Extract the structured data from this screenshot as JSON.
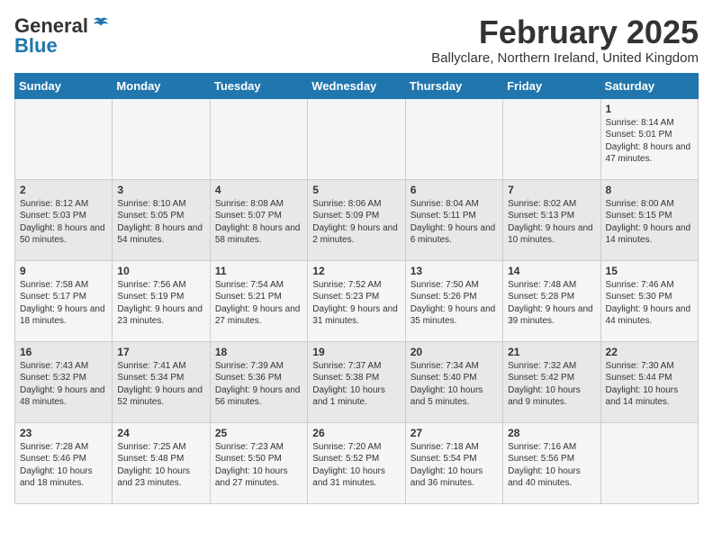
{
  "logo": {
    "general": "General",
    "blue": "Blue"
  },
  "title": "February 2025",
  "subtitle": "Ballyclare, Northern Ireland, United Kingdom",
  "days_of_week": [
    "Sunday",
    "Monday",
    "Tuesday",
    "Wednesday",
    "Thursday",
    "Friday",
    "Saturday"
  ],
  "weeks": [
    [
      {
        "day": "",
        "content": ""
      },
      {
        "day": "",
        "content": ""
      },
      {
        "day": "",
        "content": ""
      },
      {
        "day": "",
        "content": ""
      },
      {
        "day": "",
        "content": ""
      },
      {
        "day": "",
        "content": ""
      },
      {
        "day": "1",
        "content": "Sunrise: 8:14 AM\nSunset: 5:01 PM\nDaylight: 8 hours and 47 minutes."
      }
    ],
    [
      {
        "day": "2",
        "content": "Sunrise: 8:12 AM\nSunset: 5:03 PM\nDaylight: 8 hours and 50 minutes."
      },
      {
        "day": "3",
        "content": "Sunrise: 8:10 AM\nSunset: 5:05 PM\nDaylight: 8 hours and 54 minutes."
      },
      {
        "day": "4",
        "content": "Sunrise: 8:08 AM\nSunset: 5:07 PM\nDaylight: 8 hours and 58 minutes."
      },
      {
        "day": "5",
        "content": "Sunrise: 8:06 AM\nSunset: 5:09 PM\nDaylight: 9 hours and 2 minutes."
      },
      {
        "day": "6",
        "content": "Sunrise: 8:04 AM\nSunset: 5:11 PM\nDaylight: 9 hours and 6 minutes."
      },
      {
        "day": "7",
        "content": "Sunrise: 8:02 AM\nSunset: 5:13 PM\nDaylight: 9 hours and 10 minutes."
      },
      {
        "day": "8",
        "content": "Sunrise: 8:00 AM\nSunset: 5:15 PM\nDaylight: 9 hours and 14 minutes."
      }
    ],
    [
      {
        "day": "9",
        "content": "Sunrise: 7:58 AM\nSunset: 5:17 PM\nDaylight: 9 hours and 18 minutes."
      },
      {
        "day": "10",
        "content": "Sunrise: 7:56 AM\nSunset: 5:19 PM\nDaylight: 9 hours and 23 minutes."
      },
      {
        "day": "11",
        "content": "Sunrise: 7:54 AM\nSunset: 5:21 PM\nDaylight: 9 hours and 27 minutes."
      },
      {
        "day": "12",
        "content": "Sunrise: 7:52 AM\nSunset: 5:23 PM\nDaylight: 9 hours and 31 minutes."
      },
      {
        "day": "13",
        "content": "Sunrise: 7:50 AM\nSunset: 5:26 PM\nDaylight: 9 hours and 35 minutes."
      },
      {
        "day": "14",
        "content": "Sunrise: 7:48 AM\nSunset: 5:28 PM\nDaylight: 9 hours and 39 minutes."
      },
      {
        "day": "15",
        "content": "Sunrise: 7:46 AM\nSunset: 5:30 PM\nDaylight: 9 hours and 44 minutes."
      }
    ],
    [
      {
        "day": "16",
        "content": "Sunrise: 7:43 AM\nSunset: 5:32 PM\nDaylight: 9 hours and 48 minutes."
      },
      {
        "day": "17",
        "content": "Sunrise: 7:41 AM\nSunset: 5:34 PM\nDaylight: 9 hours and 52 minutes."
      },
      {
        "day": "18",
        "content": "Sunrise: 7:39 AM\nSunset: 5:36 PM\nDaylight: 9 hours and 56 minutes."
      },
      {
        "day": "19",
        "content": "Sunrise: 7:37 AM\nSunset: 5:38 PM\nDaylight: 10 hours and 1 minute."
      },
      {
        "day": "20",
        "content": "Sunrise: 7:34 AM\nSunset: 5:40 PM\nDaylight: 10 hours and 5 minutes."
      },
      {
        "day": "21",
        "content": "Sunrise: 7:32 AM\nSunset: 5:42 PM\nDaylight: 10 hours and 9 minutes."
      },
      {
        "day": "22",
        "content": "Sunrise: 7:30 AM\nSunset: 5:44 PM\nDaylight: 10 hours and 14 minutes."
      }
    ],
    [
      {
        "day": "23",
        "content": "Sunrise: 7:28 AM\nSunset: 5:46 PM\nDaylight: 10 hours and 18 minutes."
      },
      {
        "day": "24",
        "content": "Sunrise: 7:25 AM\nSunset: 5:48 PM\nDaylight: 10 hours and 23 minutes."
      },
      {
        "day": "25",
        "content": "Sunrise: 7:23 AM\nSunset: 5:50 PM\nDaylight: 10 hours and 27 minutes."
      },
      {
        "day": "26",
        "content": "Sunrise: 7:20 AM\nSunset: 5:52 PM\nDaylight: 10 hours and 31 minutes."
      },
      {
        "day": "27",
        "content": "Sunrise: 7:18 AM\nSunset: 5:54 PM\nDaylight: 10 hours and 36 minutes."
      },
      {
        "day": "28",
        "content": "Sunrise: 7:16 AM\nSunset: 5:56 PM\nDaylight: 10 hours and 40 minutes."
      },
      {
        "day": "",
        "content": ""
      }
    ]
  ]
}
